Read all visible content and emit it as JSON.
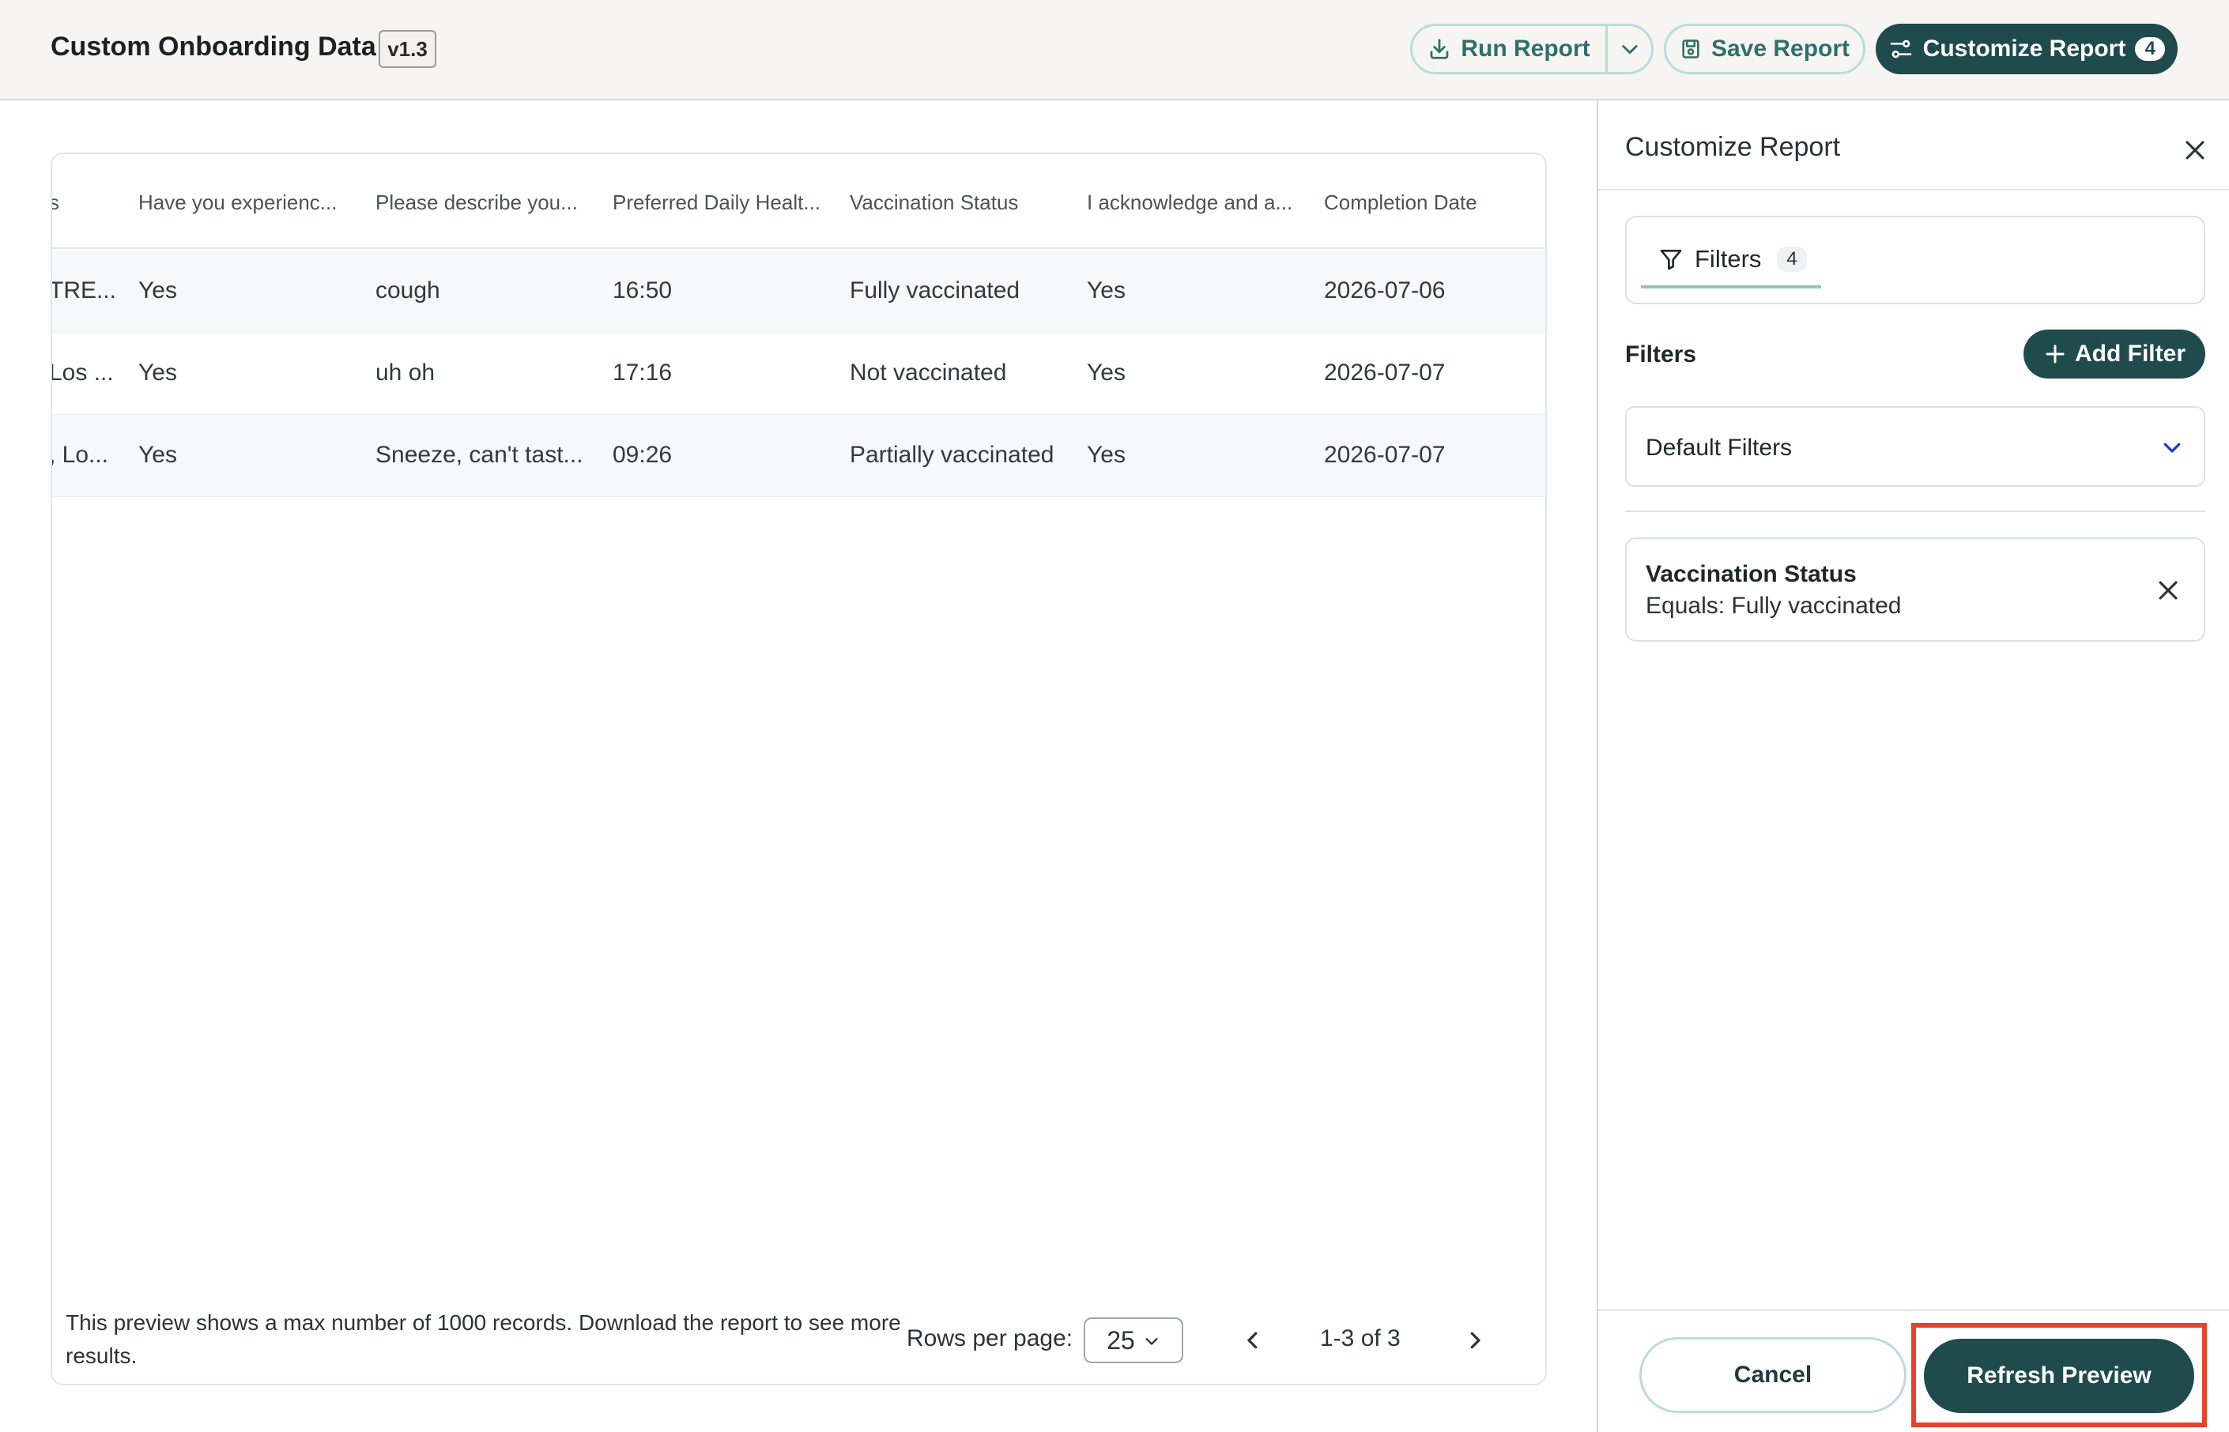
{
  "header": {
    "title": "Custom Onboarding Data",
    "version": "v1.3",
    "run_report_label": "Run Report",
    "save_report_label": "Save Report",
    "customize_report_label": "Customize Report",
    "customize_count": "4"
  },
  "table": {
    "columns": [
      "Have you experienc...",
      "Please describe you...",
      "Preferred Daily Healt...",
      "Vaccination Status",
      "I acknowledge and a...",
      "Completion Date"
    ],
    "partial_column_header": "s",
    "rows": [
      {
        "partial": "TRE...",
        "cells": [
          "Yes",
          "cough",
          "16:50",
          "Fully vaccinated",
          "Yes",
          "2026-07-06"
        ]
      },
      {
        "partial": "Los ...",
        "cells": [
          "Yes",
          "uh oh",
          "17:16",
          "Not vaccinated",
          "Yes",
          "2026-07-07"
        ]
      },
      {
        "partial": ", Lo...",
        "cells": [
          "Yes",
          "Sneeze, can't tast...",
          "09:26",
          "Partially vaccinated",
          "Yes",
          "2026-07-07"
        ]
      }
    ],
    "footer_note": "This preview shows a max number of 1000 records. Download the report to see more results.",
    "rows_per_page_label": "Rows per page:",
    "rows_per_page_value": "25",
    "page_info": "1-3 of 3"
  },
  "sidebar": {
    "title": "Customize Report",
    "tab_label": "Filters",
    "tab_count": "4",
    "filters_heading": "Filters",
    "add_filter_label": "Add Filter",
    "default_filters_label": "Default Filters",
    "filter_card": {
      "name": "Vaccination Status",
      "condition": "Equals: Fully vaccinated"
    },
    "cancel_label": "Cancel",
    "refresh_label": "Refresh Preview"
  },
  "colors": {
    "primary": "#1f4b4d",
    "outline": "#b9dcdc",
    "highlight": "#e5432b",
    "header_bg": "#f7f5f1"
  }
}
